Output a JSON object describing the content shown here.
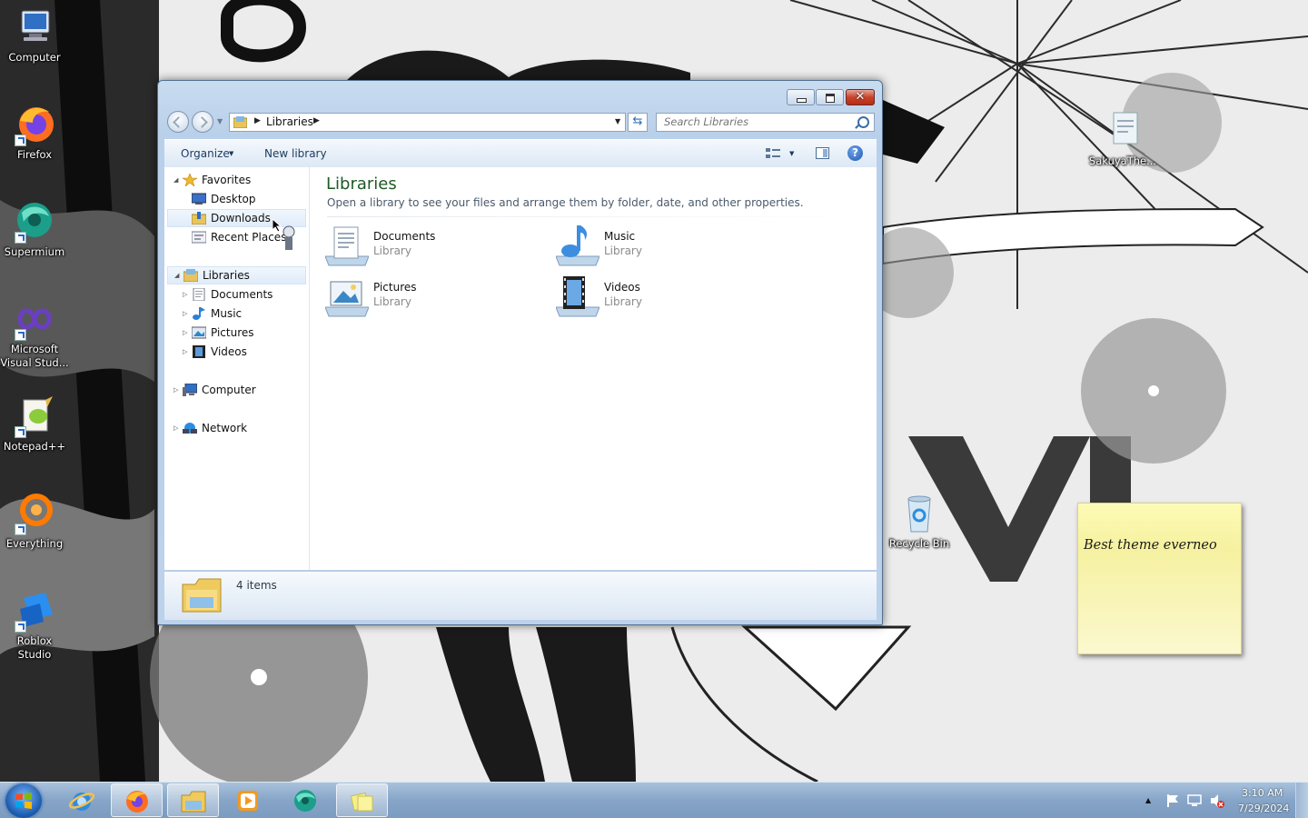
{
  "desktop": {
    "icons": [
      {
        "label": "Computer",
        "icon": "computer-icon"
      },
      {
        "label": "Firefox",
        "icon": "firefox-icon"
      },
      {
        "label": "Supermium",
        "icon": "supermium-icon"
      },
      {
        "label": "Microsoft Visual Stud...",
        "icon": "visual-studio-icon"
      },
      {
        "label": "Notepad++",
        "icon": "notepadpp-icon"
      },
      {
        "label": "Everything",
        "icon": "everything-icon"
      },
      {
        "label": "Roblox Studio",
        "icon": "roblox-studio-icon"
      },
      {
        "label": "SakuyaThe...",
        "icon": "file-icon"
      },
      {
        "label": "Recycle Bin",
        "icon": "recycle-bin-icon"
      }
    ]
  },
  "window": {
    "address": {
      "crumb": "Libraries"
    },
    "search": {
      "placeholder": "Search Libraries"
    },
    "commands": {
      "organize": "Organize",
      "new_library": "New library"
    },
    "nav": {
      "favorites": "Favorites",
      "desktop": "Desktop",
      "downloads": "Downloads",
      "recent_places": "Recent Places",
      "libraries": "Libraries",
      "lib_documents": "Documents",
      "lib_music": "Music",
      "lib_pictures": "Pictures",
      "lib_videos": "Videos",
      "computer": "Computer",
      "network": "Network"
    },
    "content": {
      "title": "Libraries",
      "description": "Open a library to see your files and arrange them by folder, date, and other properties.",
      "items": [
        {
          "name": "Documents",
          "type": "Library",
          "icon": "documents-library-icon"
        },
        {
          "name": "Music",
          "type": "Library",
          "icon": "music-library-icon"
        },
        {
          "name": "Pictures",
          "type": "Library",
          "icon": "pictures-library-icon"
        },
        {
          "name": "Videos",
          "type": "Library",
          "icon": "videos-library-icon"
        }
      ]
    },
    "details": {
      "count": "4 items"
    }
  },
  "sticky_note": {
    "text": "Best theme everneo"
  },
  "taskbar": {
    "buttons": [
      {
        "name": "internet-explorer",
        "active": false
      },
      {
        "name": "firefox",
        "active": true
      },
      {
        "name": "windows-explorer",
        "active": true
      },
      {
        "name": "media-player",
        "active": false
      },
      {
        "name": "supermium",
        "active": false
      },
      {
        "name": "sticky-notes",
        "active": true
      }
    ],
    "clock": {
      "time": "3:10 AM",
      "date": "7/29/2024"
    }
  },
  "colors": {
    "content_title": "#1e5a24",
    "window_frame": "#c9dcf0",
    "taskbar": "#86a5c8",
    "sticky": "#f6f1a0",
    "close_button": "#c9432b"
  }
}
